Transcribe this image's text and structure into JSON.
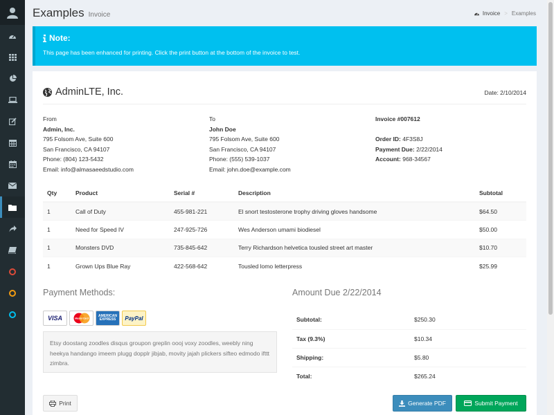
{
  "header": {
    "title": "Examples",
    "subtitle": "Invoice",
    "breadcrumb": [
      "Invoice",
      "Examples"
    ]
  },
  "callout": {
    "title": "Note:",
    "text": "This page has been enhanced for printing. Click the print button at the bottom of the invoice to test."
  },
  "invoice": {
    "company": "AdminLTE, Inc.",
    "date": "Date: 2/10/2014",
    "from": {
      "label": "From",
      "name": "Admin, Inc.",
      "address1": "795 Folsom Ave, Suite 600",
      "address2": "San Francisco, CA 94107",
      "phone": "Phone: (804) 123-5432",
      "email": "Email: info@almasaeedstudio.com"
    },
    "to": {
      "label": "To",
      "name": "John Doe",
      "address1": "795 Folsom Ave, Suite 600",
      "address2": "San Francisco, CA 94107",
      "phone": "Phone: (555) 539-1037",
      "email": "Email: john.doe@example.com"
    },
    "meta": {
      "invoice_no": "Invoice #007612",
      "order_label": "Order ID:",
      "order_value": "4F3S8J",
      "due_label": "Payment Due:",
      "due_value": "2/22/2014",
      "account_label": "Account:",
      "account_value": "968-34567"
    },
    "table": {
      "headers": [
        "Qty",
        "Product",
        "Serial #",
        "Description",
        "Subtotal"
      ],
      "rows": [
        [
          "1",
          "Call of Duty",
          "455-981-221",
          "El snort testosterone trophy driving gloves handsome",
          "$64.50"
        ],
        [
          "1",
          "Need for Speed IV",
          "247-925-726",
          "Wes Anderson umami biodiesel",
          "$50.00"
        ],
        [
          "1",
          "Monsters DVD",
          "735-845-642",
          "Terry Richardson helvetica tousled street art master",
          "$10.70"
        ],
        [
          "1",
          "Grown Ups Blue Ray",
          "422-568-642",
          "Tousled lomo letterpress",
          "$25.99"
        ]
      ]
    },
    "payment": {
      "title": "Payment Methods:",
      "cards": [
        "VISA",
        "MasterCard",
        "AMERICAN EXPRESS",
        "PayPal"
      ],
      "note": "Etsy doostang zoodles disqus groupon greplin oooj voxy zoodles, weebly ning heekya handango imeem plugg dopplr jibjab, movity jajah plickers sifteo edmodo ifttt zimbra."
    },
    "amount": {
      "title": "Amount Due 2/22/2014",
      "rows": [
        {
          "label": "Subtotal:",
          "value": "$250.30"
        },
        {
          "label": "Tax (9.3%)",
          "value": "$10.34"
        },
        {
          "label": "Shipping:",
          "value": "$5.80"
        },
        {
          "label": "Total:",
          "value": "$265.24"
        }
      ]
    },
    "buttons": {
      "print": "Print",
      "pdf": "Generate PDF",
      "submit": "Submit Payment"
    }
  },
  "colors": {
    "sidebar": "#222d32",
    "callout": "#00c0ef",
    "primary": "#3c8dbc",
    "success": "#00a65a",
    "ring_red": "#dd4b39",
    "ring_yellow": "#f39c12",
    "ring_aqua": "#00c0ef"
  },
  "sidebar_icons": [
    "user-avatar-icon",
    "dashboard-icon",
    "th-icon",
    "pie-chart-icon",
    "laptop-icon",
    "edit-icon",
    "table-icon",
    "calendar-icon",
    "envelope-icon",
    "folder-icon",
    "share-icon",
    "book-icon",
    "circle-red-icon",
    "circle-yellow-icon",
    "circle-aqua-icon"
  ]
}
